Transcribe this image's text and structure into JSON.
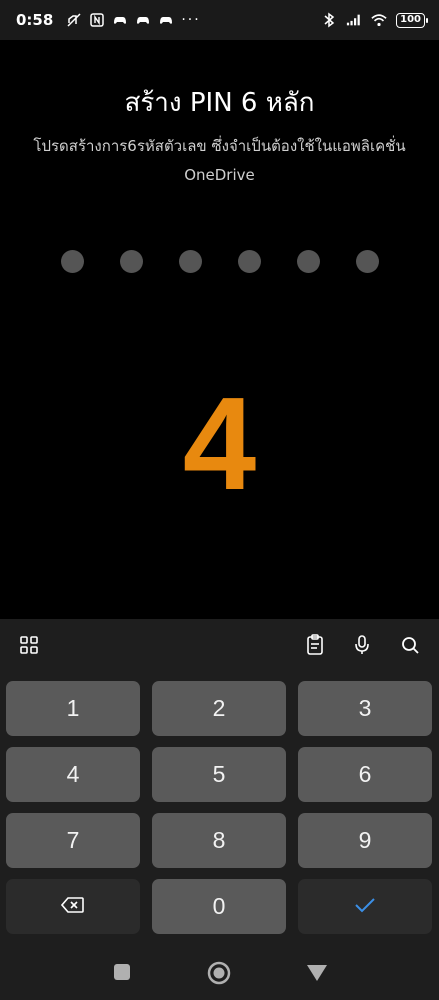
{
  "status_bar": {
    "time": "0:58",
    "more": "···",
    "battery": "100",
    "icons": [
      "silent-icon",
      "nfc-icon",
      "game-controller-icon",
      "game-controller-icon",
      "game-controller-icon",
      "bluetooth-icon",
      "signal-icon",
      "wifi-icon",
      "battery-icon"
    ]
  },
  "main": {
    "title": "สร้าง PIN 6 หลัก",
    "subtitle": "โปรดสร้างการ6รหัสตัวเลข ซึ่งจำเป็นต้องใช้ในแอพลิเคชั่น OneDrive",
    "pin_length": 6,
    "pin_entered": 0,
    "typed_digit": "4"
  },
  "keyboard": {
    "toolbar_icons": [
      "apps-grid-icon",
      "clipboard-icon",
      "microphone-icon",
      "search-icon"
    ],
    "keys": [
      "1",
      "2",
      "3",
      "4",
      "5",
      "6",
      "7",
      "8",
      "9"
    ],
    "zero": "0",
    "backspace_icon": "backspace-icon",
    "confirm_icon": "checkmark-icon"
  },
  "nav_bar": {
    "icons": [
      "recent-apps-icon",
      "home-icon",
      "back-icon"
    ]
  },
  "colors": {
    "accent_digit": "#e8890f",
    "confirm_check": "#3b8fe6",
    "key_bg": "#5a5a5a"
  }
}
